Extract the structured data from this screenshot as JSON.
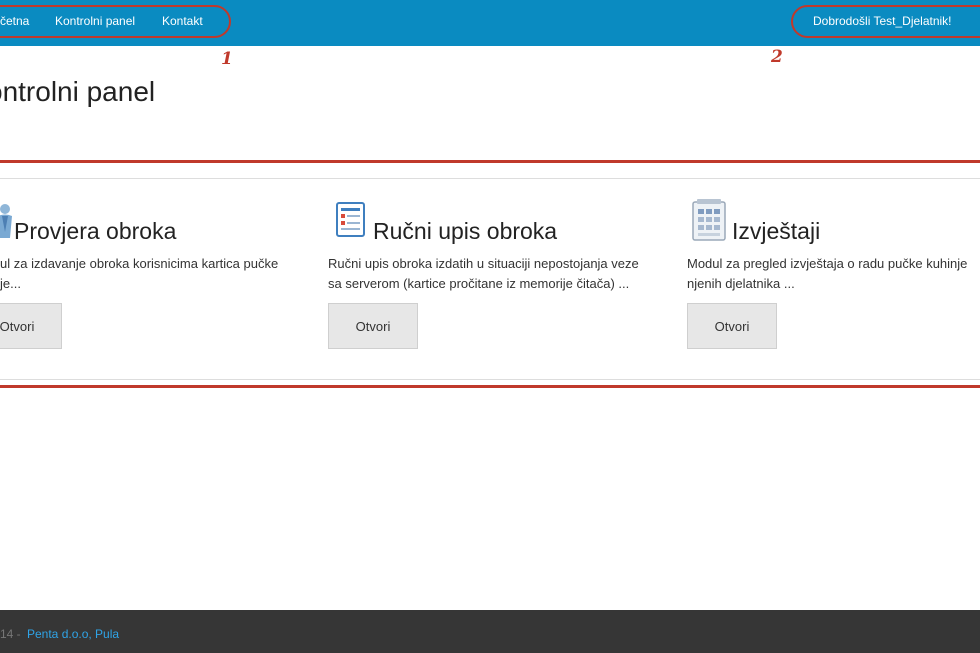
{
  "nav": {
    "items": [
      {
        "label": "četna"
      },
      {
        "label": "Kontrolni panel"
      },
      {
        "label": "Kontakt"
      }
    ],
    "welcome": "Dobrodošli Test_Djelatnik!"
  },
  "annotations": {
    "marker_1": "1",
    "marker_2": "2",
    "color": "#c0392b"
  },
  "page": {
    "title": "ontrolni panel"
  },
  "modules": [
    {
      "title": "Provjera obroka",
      "desc_line1": "ul za izdavanje obroka korisnicima kartica pučke",
      "desc_line2": "je...",
      "button": "Otvori",
      "icon": "person-icon"
    },
    {
      "title": "Ručni upis obroka",
      "desc_line1": "Ručni upis obroka izdatih u situaciji nepostojanja veze",
      "desc_line2": "sa serverom (kartice pročitane iz memorije čitača) ...",
      "button": "Otvori",
      "icon": "form-icon"
    },
    {
      "title": "Izvještaji",
      "desc_line1": "Modul za pregled izvještaja o radu pučke kuhinje",
      "desc_line2": "njenih djelatnika ...",
      "button": "Otvori",
      "icon": "report-icon"
    }
  ],
  "footer": {
    "year": "14 -",
    "company": "Penta d.o.o, Pula"
  },
  "colors": {
    "navbar": "#0a8bc1",
    "footer": "#363636",
    "link": "#2fa4e7"
  }
}
